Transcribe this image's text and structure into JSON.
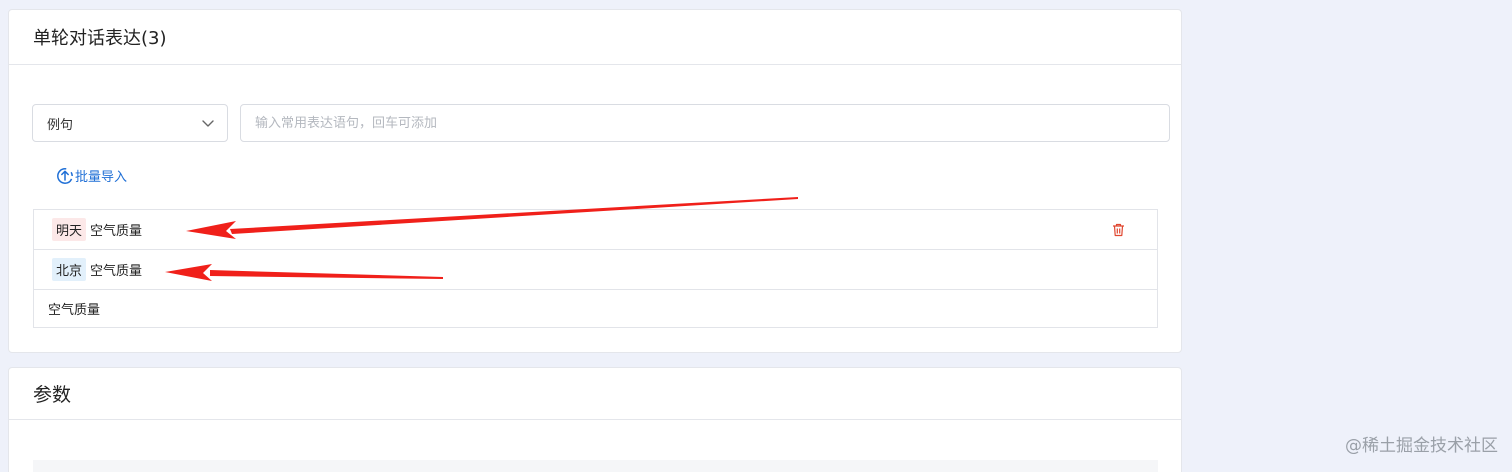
{
  "section1": {
    "title": "单轮对话表达(3)",
    "select_value": "例句",
    "input_placeholder": "输入常用表达语句，回车可添加",
    "import_label": "批量导入",
    "rows": [
      {
        "tag": "明天",
        "tag_color": "#fce8e8",
        "text": "空气质量"
      },
      {
        "tag": "北京",
        "tag_color": "#e2f0fb",
        "text": "空气质量"
      },
      {
        "text": "空气质量"
      }
    ]
  },
  "section2": {
    "title": "参数"
  },
  "watermark": "@稀土掘金技术社区",
  "colors": {
    "accent": "#1f6fd6",
    "delete": "#e0462f",
    "annotation_arrow": "#f0201a",
    "background": "#eef1fa"
  }
}
